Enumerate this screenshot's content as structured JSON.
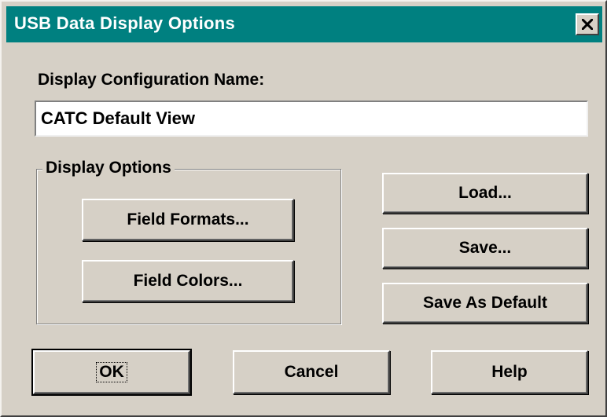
{
  "window": {
    "title": "USB Data Display Options",
    "titlebar_color": "#008080",
    "face_color": "#d6d0c6",
    "close_icon": "close-x-icon"
  },
  "config": {
    "label": "Display Configuration Name:",
    "value": "CATC Default View"
  },
  "display_options": {
    "legend": "Display Options",
    "field_formats_label": "Field Formats...",
    "field_colors_label": "Field Colors..."
  },
  "file_buttons": {
    "load_label": "Load...",
    "save_label": "Save...",
    "save_default_label": "Save As Default"
  },
  "footer": {
    "ok_label": "OK",
    "cancel_label": "Cancel",
    "help_label": "Help"
  }
}
